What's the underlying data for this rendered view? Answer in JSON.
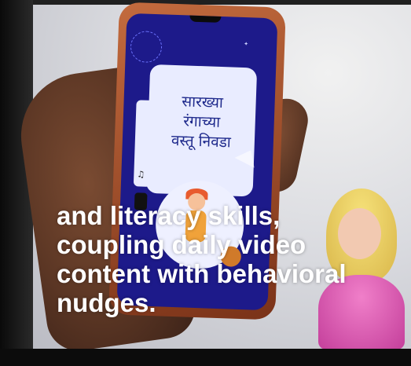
{
  "phone_screen": {
    "lines": [
      "सारख्या",
      "रंगाच्या",
      "वस्तू निवडा"
    ]
  },
  "caption": {
    "lines": [
      "and literacy skills,",
      "coupling daily video",
      "content with behavioral",
      "nudges."
    ]
  },
  "colors": {
    "screen": "#1d1a8a",
    "card": "#e9ecff",
    "caption_text": "#ffffff"
  },
  "icons": [
    "music-note-icon",
    "menu-dots-icon",
    "cursor-arrow-icon"
  ]
}
